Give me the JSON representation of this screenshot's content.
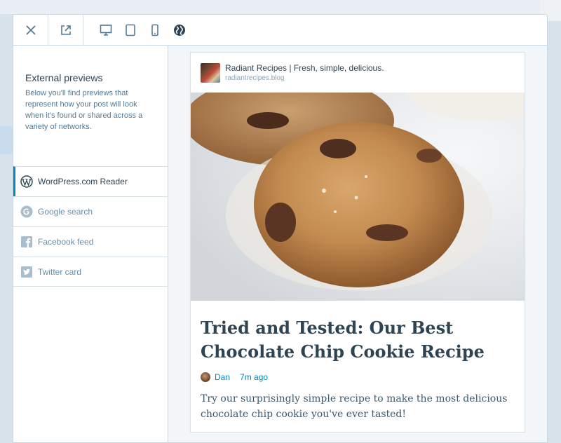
{
  "toolbar": {
    "close_icon": "close-icon",
    "external_icon": "external-link-icon",
    "devices": [
      "desktop-icon",
      "tablet-icon",
      "phone-icon",
      "globe-icon"
    ]
  },
  "sidebar": {
    "title": "External previews",
    "description": "Below you'll find previews that represent how your post will look when it's found or shared across a variety of networks.",
    "items": [
      {
        "label": "WordPress.com Reader",
        "icon": "wordpress-icon",
        "active": true
      },
      {
        "label": "Google search",
        "icon": "google-icon",
        "active": false
      },
      {
        "label": "Facebook feed",
        "icon": "facebook-icon",
        "active": false
      },
      {
        "label": "Twitter card",
        "icon": "twitter-icon",
        "active": false
      }
    ]
  },
  "card": {
    "site_name": "Radiant Recipes | Fresh, simple, delicious.",
    "site_url": "radiantrecipes.blog",
    "post_title": "Tried and Tested: Our Best Chocolate Chip Cookie Recipe",
    "author": "Dan",
    "time": "7m ago",
    "excerpt": "Try our surprisingly simple recipe to make the most delicious chocolate chip cookie you've ever tasted!"
  },
  "colors": {
    "accent": "#0087be",
    "text_dark": "#2e4453",
    "text_muted": "#668eaa"
  }
}
